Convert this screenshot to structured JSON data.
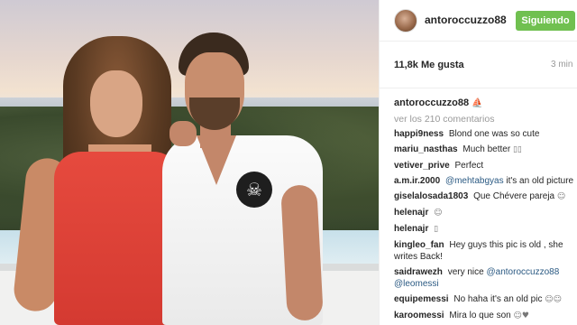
{
  "header": {
    "username": "antoroccuzzo88",
    "follow_label": "Siguiendo"
  },
  "stats": {
    "likes": "11,8k Me gusta",
    "time": "3 min"
  },
  "caption": {
    "user": "antoroccuzzo88",
    "emoji": "⛵"
  },
  "view_all": "ver los 210 comentarios",
  "comments": [
    {
      "user": "happi9ness",
      "text": "Blond one was so cute",
      "emoji": ""
    },
    {
      "user": "mariu_nasthas",
      "text": "Much better",
      "emoji": "▯▯"
    },
    {
      "user": "vetiver_prive",
      "text": "Perfect",
      "emoji": ""
    },
    {
      "user": "a.m.ir.2000",
      "mention": "@mehtabgyas",
      "text": "it's an old picture",
      "emoji": ""
    },
    {
      "user": "giselalosada1803",
      "text": "Que Chévere pareja",
      "emoji": "☺"
    },
    {
      "user": "helenajr",
      "text": "",
      "emoji": "☺"
    },
    {
      "user": "helenajr",
      "text": "",
      "emoji": "▯"
    },
    {
      "user": "kingleo_fan",
      "text": "Hey guys this pic is old , she writes Back!",
      "emoji": ""
    },
    {
      "user": "saidrawezh",
      "text": "very nice",
      "mention": "@antoroccuzzo88 @leomessi",
      "emoji": ""
    },
    {
      "user": "equipemessi",
      "text": "No haha it's an old pic",
      "emoji": "☺☺"
    },
    {
      "user": "karoomessi",
      "text": "Mira lo que son",
      "emoji": "☺♥"
    }
  ]
}
